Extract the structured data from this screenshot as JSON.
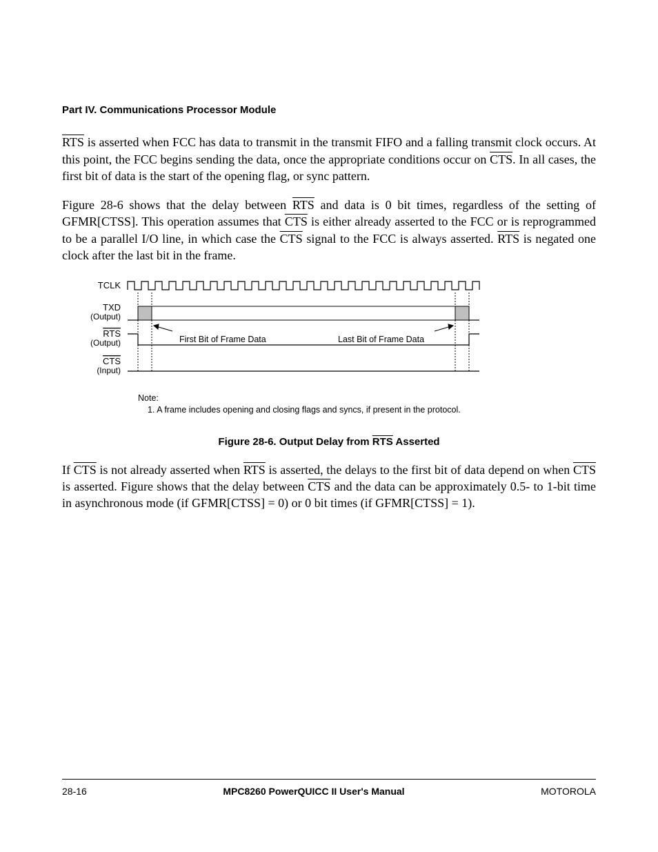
{
  "header": {
    "part": "Part IV.  Communications Processor Module"
  },
  "paragraphs": {
    "p1a": " is asserted when FCC has data to transmit in the transmit FIFO and a falling transmit clock occurs. At this point, the FCC begins sending the data, once the appropriate conditions occur on ",
    "p1b": ". In all cases, the first bit of data is the start of the opening flag, or sync pattern.",
    "p2a": "Figure 28-6 shows that the delay between ",
    "p2b": " and data is 0 bit times, regardless of the setting of GFMR[CTSS]. This operation assumes that ",
    "p2c": " is either already asserted to the FCC or is reprogrammed to be a parallel I/O line, in which case the ",
    "p2d": " signal to the FCC is always asserted. ",
    "p2e": " is negated one clock after the last bit in the frame.",
    "p3a": "If ",
    "p3b": " is not already asserted when ",
    "p3c": " is asserted, the delays to the first bit of data depend on when ",
    "p3d": " is asserted. Figure  shows that the delay between ",
    "p3e": " and the data can be approximately 0.5- to 1-bit time in asynchronous mode (if GFMR[CTSS] = 0) or 0 bit times (if GFMR[CTSS] = 1)."
  },
  "signals": {
    "rts": "RTS",
    "cts": "CTS"
  },
  "diagram": {
    "tclk": "TCLK",
    "txd": "TXD",
    "txd_sub": "(Output)",
    "rts": "RTS",
    "rts_sub": "(Output)",
    "cts": "CTS",
    "cts_sub": "(Input)",
    "first": "First Bit of Frame Data",
    "last": "Last Bit of Frame Data",
    "note_label": "Note:",
    "note_text": "1. A frame includes opening and closing flags and syncs, if present in the protocol."
  },
  "figure": {
    "caption_pre": "Figure 28-6. Output Delay from ",
    "caption_post": " Asserted"
  },
  "footer": {
    "pageno": "28-16",
    "title": "MPC8260 PowerQUICC II User's Manual",
    "brand": "MOTOROLA"
  }
}
